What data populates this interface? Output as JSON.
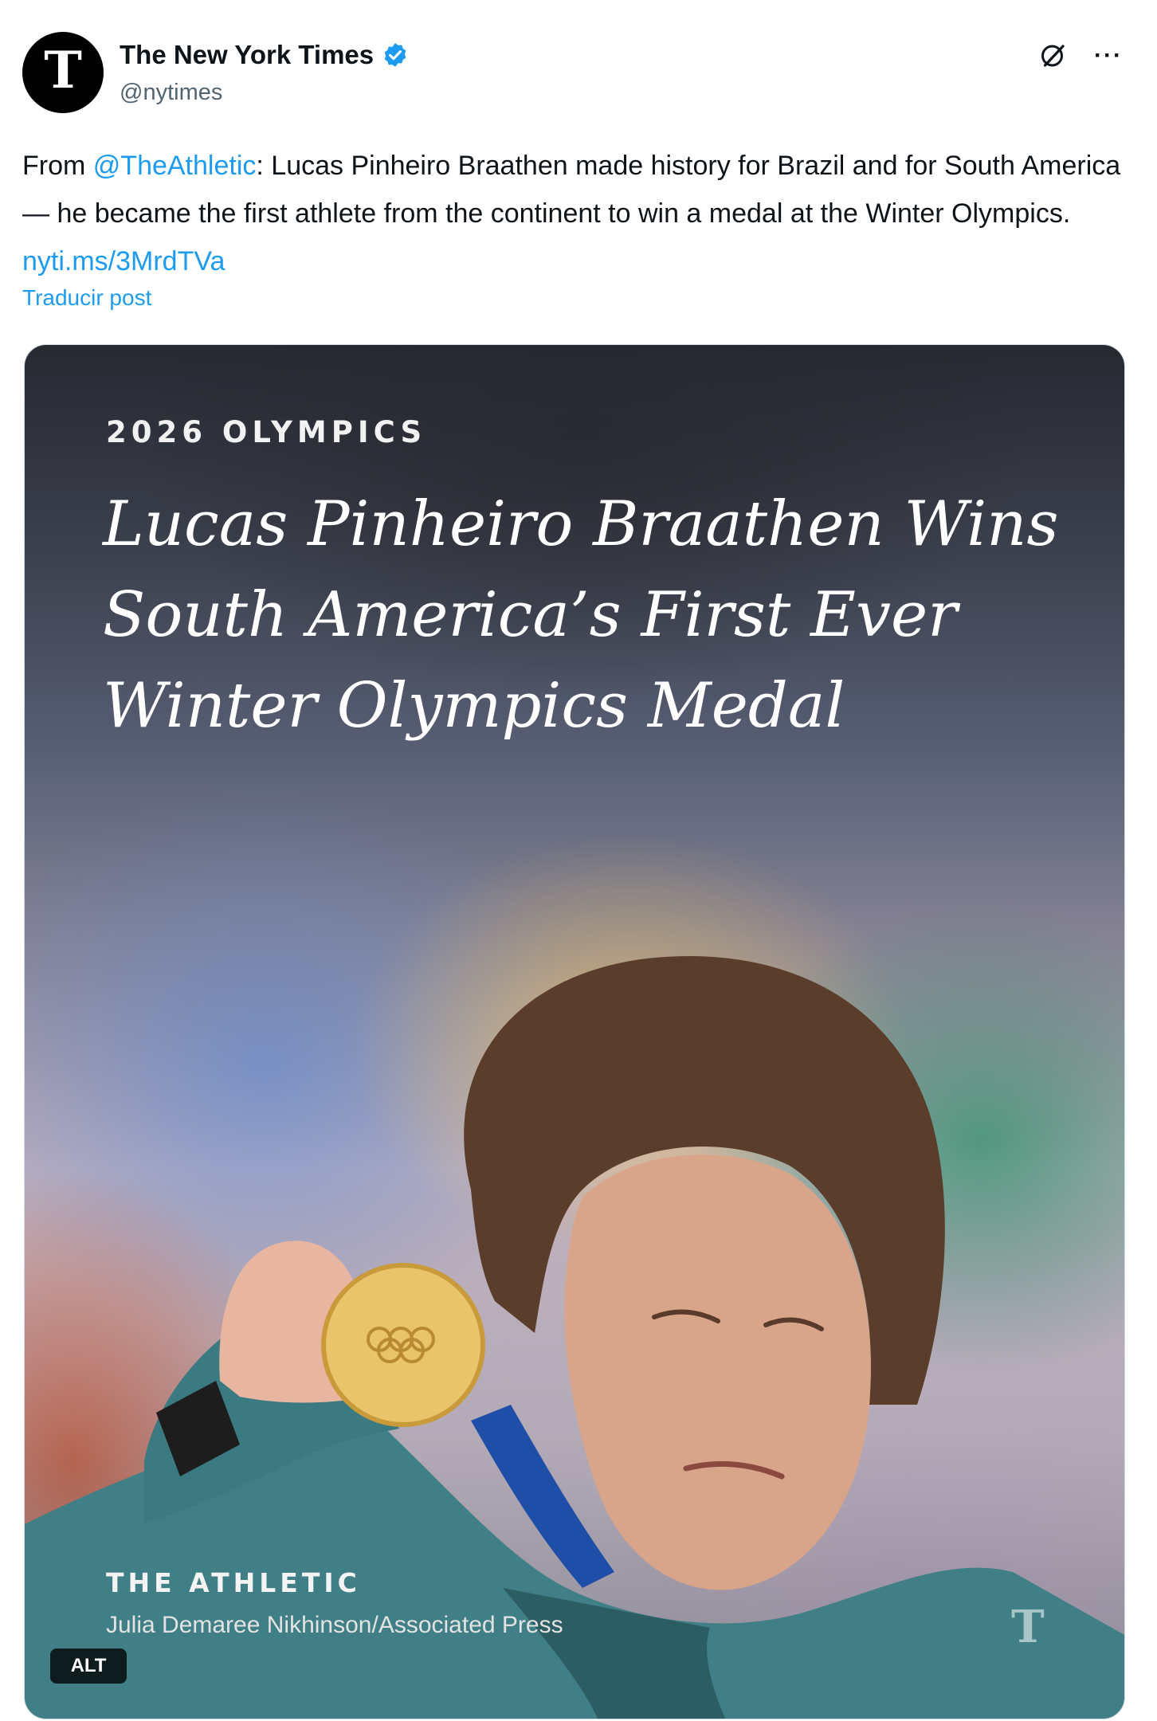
{
  "author": {
    "display_name": "The New York Times",
    "handle": "@nytimes",
    "avatar_glyph": "T",
    "verified_color": "#1d9bf0"
  },
  "header": {
    "grok_icon": "grok-icon",
    "more_label": "···"
  },
  "tweet": {
    "prefix": "From ",
    "mention": "@TheAthletic",
    "text": ": Lucas Pinheiro Braathen made history for Brazil and for South America — he became the first athlete from the continent to win a medal at the Winter Olympics. ",
    "link": "nyti.ms/3MrdTVa",
    "translate_label": "Traducir post"
  },
  "media": {
    "kicker": "2026 OLYMPICS",
    "headline": "Lucas Pinheiro Braathen Wins South America’s First Ever Winter Olympics Medal",
    "brand": "THE ATHLETIC",
    "credit": "Julia Demaree Nikhinson/Associated Press",
    "watermark": "T",
    "alt_label": "ALT"
  },
  "colors": {
    "link": "#1d9bf0",
    "text": "#0f1419",
    "secondary": "#536471"
  }
}
